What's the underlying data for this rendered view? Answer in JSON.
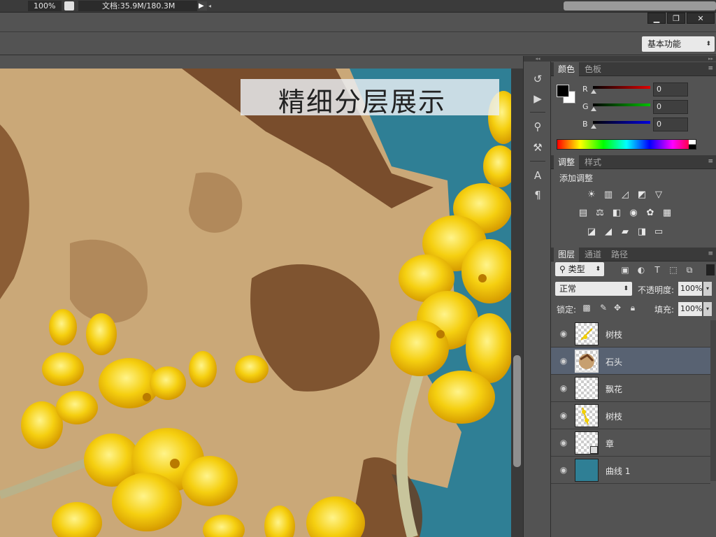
{
  "statusbar": {
    "zoom": "100%",
    "doc_info": "文档:35.9M/180.3M"
  },
  "optionsbar": {
    "workspace": "基本功能"
  },
  "canvas": {
    "banner_text": "精细分层展示"
  },
  "color_panel": {
    "tabs": [
      "颜色",
      "色板"
    ],
    "active_tab": "颜色",
    "foreground": "#000000",
    "background": "#ffffff",
    "channels": [
      {
        "label": "R",
        "value": "0",
        "color": "#e00000"
      },
      {
        "label": "G",
        "value": "0",
        "color": "#00c000"
      },
      {
        "label": "B",
        "value": "0",
        "color": "#0000e0"
      }
    ]
  },
  "adjustments_panel": {
    "tabs": [
      "调整",
      "样式"
    ],
    "active_tab": "调整",
    "title": "添加调整",
    "icons_row1": [
      "brightness-icon",
      "levels-icon",
      "curves-icon",
      "exposure-icon",
      "vibrance-icon"
    ],
    "icons_row2": [
      "hue-saturation-icon",
      "color-balance-icon",
      "black-white-icon",
      "photo-filter-icon",
      "channel-mixer-icon",
      "color-lookup-icon"
    ],
    "icons_row3": [
      "invert-icon",
      "posterize-icon",
      "threshold-icon",
      "selective-color-icon",
      "gradient-map-icon"
    ]
  },
  "layers_panel": {
    "tabs": [
      "图层",
      "通道",
      "路径"
    ],
    "active_tab": "图层",
    "kind_filter": "类型",
    "blend_mode": "正常",
    "opacity_label": "不透明度:",
    "opacity": "100%",
    "lock_label": "锁定:",
    "fill_label": "填充:",
    "fill": "100%",
    "layers": [
      {
        "name": "树枝",
        "selected": false,
        "thumb": "branch"
      },
      {
        "name": "石头",
        "selected": true,
        "thumb": "stone"
      },
      {
        "name": "飘花",
        "selected": false,
        "thumb": "empty"
      },
      {
        "name": "树枝",
        "selected": false,
        "thumb": "branch"
      },
      {
        "name": "章",
        "selected": false,
        "thumb": "smart"
      },
      {
        "name": "曲线 1",
        "selected": false,
        "thumb": "curves"
      }
    ]
  }
}
